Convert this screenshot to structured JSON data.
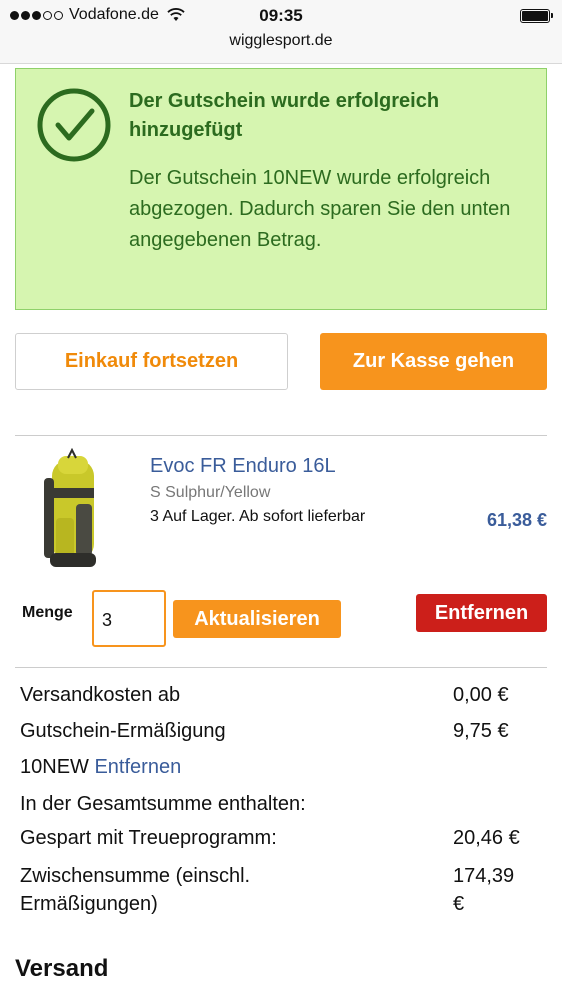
{
  "status_bar": {
    "carrier": "Vodafone.de",
    "time": "09:35",
    "url": "wigglesport.de"
  },
  "banner": {
    "title": "Der Gutschein wurde erfolgreich hinzugefügt",
    "message": "Der Gutschein 10NEW wurde erfolgreich abgezogen. Dadurch sparen Sie den unten angegebenen Betrag.",
    "icon": "checkmark-circle-icon"
  },
  "actions": {
    "continue_shopping": "Einkauf fortsetzen",
    "checkout": "Zur Kasse gehen"
  },
  "product": {
    "name": "Evoc FR Enduro 16L",
    "variant": "S Sulphur/Yellow",
    "stock": "3 Auf Lager. Ab sofort lieferbar",
    "price": "61,38 €",
    "quantity_label": "Menge",
    "quantity": "3",
    "update_label": "Aktualisieren",
    "remove_label": "Entfernen"
  },
  "summary": {
    "shipping_label": "Versandkosten ab",
    "shipping_value": "0,00 €",
    "voucher_label": "Gutschein-Ermäßigung",
    "voucher_value": "9,75 €",
    "voucher_code": "10NEW",
    "voucher_remove": "Entfernen",
    "included_label": "In der Gesamtsumme enthalten:",
    "loyalty_label": "Gespart mit Treueprogramm:",
    "loyalty_value": "20,46 €",
    "subtotal_label_1": "Zwischensumme (einschl.",
    "subtotal_label_2": "Ermäßigungen)",
    "subtotal_value_1": "174,39",
    "subtotal_value_2": "€"
  },
  "shipping_heading": "Versand",
  "colors": {
    "accent_orange": "#f7941d",
    "success_bg": "#d6f5b0",
    "success_text": "#2c6b1f",
    "link_blue": "#3a5c9a",
    "danger_red": "#cc1f1a"
  }
}
